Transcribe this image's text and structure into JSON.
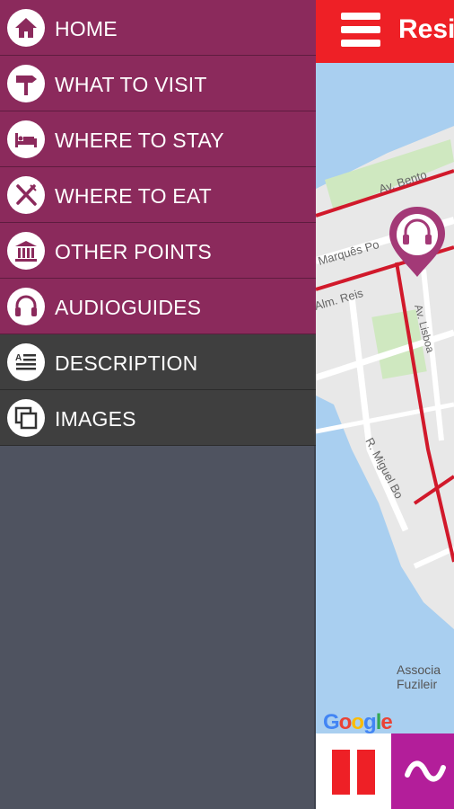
{
  "app": {
    "title": "Resis"
  },
  "drawer": {
    "items": [
      {
        "label": "HOME",
        "icon": "home-icon",
        "section": "primary"
      },
      {
        "label": "WHAT TO VISIT",
        "icon": "signpost-icon",
        "section": "primary"
      },
      {
        "label": "WHERE TO STAY",
        "icon": "bed-icon",
        "section": "primary"
      },
      {
        "label": "WHERE TO EAT",
        "icon": "fork-knife-icon",
        "section": "primary"
      },
      {
        "label": "OTHER POINTS",
        "icon": "landmark-icon",
        "section": "primary"
      },
      {
        "label": "AUDIOGUIDES",
        "icon": "headphones-icon",
        "section": "primary"
      },
      {
        "label": "DESCRIPTION",
        "icon": "text-document-icon",
        "section": "secondary"
      },
      {
        "label": "IMAGES",
        "icon": "images-icon",
        "section": "secondary"
      }
    ]
  },
  "map": {
    "street_labels": [
      "Av. Bento",
      "Marquês Po",
      "Alm. Reis",
      "Av. Lisboa",
      "R. Miguel Bo"
    ],
    "poi_label_line1": "Associa",
    "poi_label_line2": "Fuzileir",
    "attribution": "Google"
  },
  "colors": {
    "primary": "#8b2a5c",
    "secondary": "#3f3f3f",
    "drawer_bg": "#4f5360",
    "accent_red": "#ee2026",
    "accent_purple": "#b31e9a"
  }
}
